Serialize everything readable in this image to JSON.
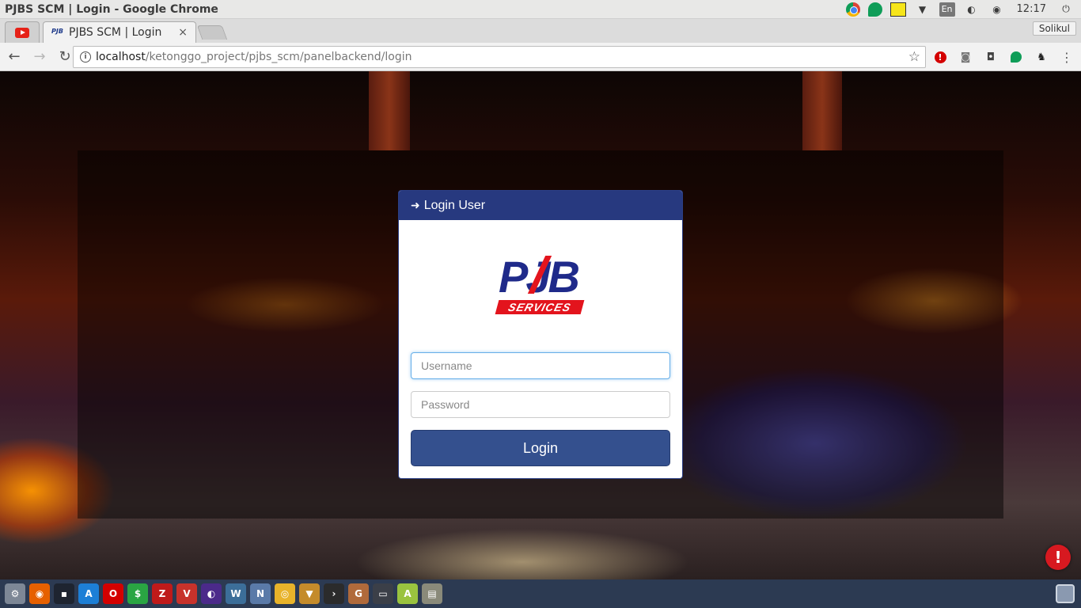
{
  "os": {
    "window_title": "PJBS SCM | Login - Google Chrome",
    "clock": "12:17",
    "keyboard_layout": "En",
    "tray_icons": [
      "chrome-icon",
      "hangouts-icon",
      "notes-icon",
      "wifi-icon",
      "keyboard-layout-icon",
      "sync-icon",
      "network-icon",
      "clock",
      "power-icon"
    ]
  },
  "browser": {
    "tabs": [
      {
        "label": "",
        "icon": "youtube-icon"
      },
      {
        "label": "PJBS SCM | Login",
        "icon": "pjb-favicon",
        "active": true
      }
    ],
    "close_glyph": "×",
    "profile_name": "Solikul",
    "url_host": "localhost",
    "url_path": "/ketonggo_project/pjbs_scm/panelbackend/login",
    "extensions": [
      "adblock-icon",
      "camera-icon",
      "bulb-icon",
      "hangouts-icon",
      "wolf-icon",
      "menu-icon"
    ]
  },
  "login": {
    "header_icon": "sign-in-icon",
    "header_text": "Login User",
    "logo_text": "PJB",
    "logo_subtext": "SERVICES",
    "username_placeholder": "Username",
    "password_placeholder": "Password",
    "button_label": "Login"
  },
  "page": {
    "notification_glyph": "!"
  },
  "colors": {
    "panel_header": "#27397f",
    "login_button": "#34508e",
    "logo_blue": "#1f2a8a",
    "logo_red": "#e3141d",
    "focus_border": "#66afe9"
  },
  "dock": {
    "apps": [
      {
        "name": "settings-app-icon",
        "color": "#7d8796",
        "glyph": "⚙"
      },
      {
        "name": "firefox-app-icon",
        "color": "#e66000",
        "glyph": "◉"
      },
      {
        "name": "terminal-app-icon",
        "color": "#1e2430",
        "glyph": "▪"
      },
      {
        "name": "app-store-icon",
        "color": "#1d7fd6",
        "glyph": "A"
      },
      {
        "name": "opera-app-icon",
        "color": "#d40000",
        "glyph": "O"
      },
      {
        "name": "money-app-icon",
        "color": "#2aa543",
        "glyph": "$"
      },
      {
        "name": "filezilla-app-icon",
        "color": "#bf1a1a",
        "glyph": "Z"
      },
      {
        "name": "ssl-vpn-app-icon",
        "color": "#c7322b",
        "glyph": "V"
      },
      {
        "name": "eclipse-app-icon",
        "color": "#4b2a8a",
        "glyph": "◐"
      },
      {
        "name": "workbench-app-icon",
        "color": "#3c6e99",
        "glyph": "W"
      },
      {
        "name": "network-app-icon",
        "color": "#5a7aa8",
        "glyph": "N"
      },
      {
        "name": "chrome-app-icon",
        "color": "#e8b32a",
        "glyph": "◎"
      },
      {
        "name": "installer-app-icon",
        "color": "#c48b2b",
        "glyph": "▼"
      },
      {
        "name": "console-app-icon",
        "color": "#2b2b2b",
        "glyph": "›"
      },
      {
        "name": "gimp-app-icon",
        "color": "#b06a3b",
        "glyph": "G"
      },
      {
        "name": "screen-app-icon",
        "color": "#3b3f48",
        "glyph": "▭"
      },
      {
        "name": "android-studio-icon",
        "color": "#9ac33f",
        "glyph": "A"
      },
      {
        "name": "archive-app-icon",
        "color": "#8a8a7a",
        "glyph": "▤"
      }
    ]
  }
}
